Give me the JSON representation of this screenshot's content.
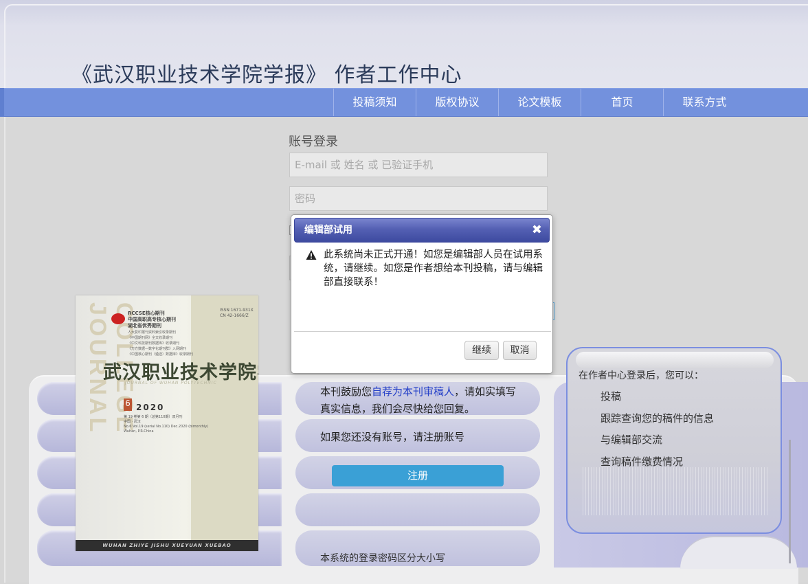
{
  "header": {
    "title": "《武汉职业技术学院学报》   作者工作中心"
  },
  "nav": {
    "items": [
      {
        "label": "投稿须知"
      },
      {
        "label": "版权协议"
      },
      {
        "label": "论文模板"
      },
      {
        "label": "首页"
      },
      {
        "label": "联系方式"
      }
    ]
  },
  "login": {
    "title": "账号登录",
    "username_placeholder": "E-mail 或 姓名 或 已验证手机",
    "password_placeholder": "密码"
  },
  "cover": {
    "vertical_text": "COLLEGE JOURNAL",
    "cat_lines": "RCCSE核心期刊\n中国高职高专核心期刊\n湖北省优秀期刊",
    "issn": "ISSN 1671-931X\nCN 42-1666/Z",
    "small_lines": "人大复印报刊资料索引收录期刊\n《中国期刊网》全文收录期刊\n《中文科技期刊数据库》收录期刊\n《万方数据—数字化期刊群》入网期刊\n《中国核心期刊（遴选）数据库》收录期刊",
    "title": "武汉职业技术学院学报",
    "en_title": "JOURNAL OF WUHAN POLYTECHNIC",
    "issue": "6",
    "year": "2020",
    "vol": "第 19 卷第 6 期（总第110期）双月刊\n中国 · 武汉\nNo.6 Vol.19 (serial No.110) Dec.2020 (bimonthly)\nWuhan, P.R.China",
    "footer": "WUHAN ZHIYE JISHU XUEYUAN XUEBAO"
  },
  "info": {
    "encourage_prefix": "本刊鼓励您",
    "encourage_link": "自荐为本刊审稿人",
    "encourage_suffix": "，请如实填写",
    "encourage_line2": "真实信息，我们会尽快给您回复。",
    "no_account": "如果您还没有账号，请注册账号",
    "register_label": "注册",
    "case_note": "本系统的登录密码区分大小写"
  },
  "card": {
    "heading": "在作者中心登录后，您可以：",
    "items": [
      "投稿",
      "跟踪查询您的稿件的信息",
      "与编辑部交流",
      "查询稿件缴费情况"
    ]
  },
  "modal": {
    "title": "编辑部试用",
    "close_icon": "✖",
    "message": "此系统尚未正式开通！如您是编辑部人员在试用系统，请继续。如您是作者想给本刊投稿，请与编辑部直接联系！",
    "continue_label": "继续",
    "cancel_label": "取消"
  }
}
